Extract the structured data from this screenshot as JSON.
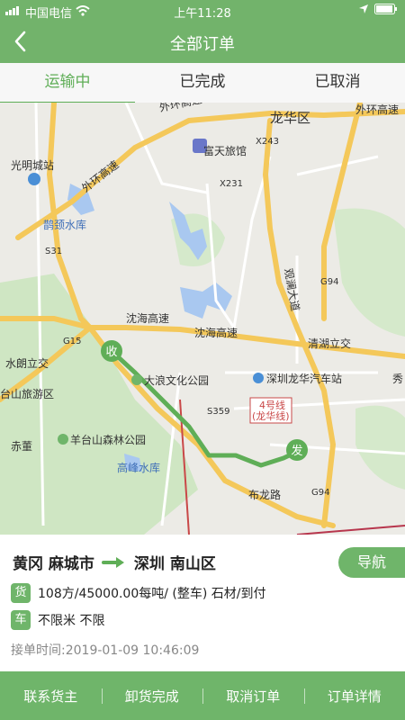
{
  "status_bar": {
    "carrier": "中国电信",
    "time": "上午11:28"
  },
  "nav": {
    "title": "全部订单"
  },
  "tabs": [
    {
      "label": "运输中",
      "active": true
    },
    {
      "label": "已完成",
      "active": false
    },
    {
      "label": "已取消",
      "active": false
    }
  ],
  "map": {
    "labels": {
      "huanhuan": "外环高速",
      "longhua": "龙华区",
      "waihuan_right": "外环高速",
      "futian": "富天旅馆",
      "x243": "X243",
      "guangming": "光明城站",
      "waihuan_left": "外环高速",
      "x231": "X231",
      "quejing": "鹊颈水库",
      "s31": "S31",
      "guanlan": "观澜大道",
      "g94a": "G94",
      "shenhai_left": "沈海高速",
      "shenhai_mid": "沈海高速",
      "qinghu": "清湖立交",
      "g15": "G15",
      "shuirun": "水朗立交",
      "dalang": "大浪文化公园",
      "longhua_station": "深圳龙华汽车站",
      "xiu": "秀",
      "taishan": "台山旅游区",
      "metro": "4号线",
      "metro_sub": "(龙华线)",
      "s359": "S359",
      "chidong": "赤董",
      "yangtai": "羊台山森林公园",
      "gaofeng": "高峰水库",
      "bulong": "布龙路",
      "g94b": "G94"
    },
    "marker_receive": "收",
    "marker_send": "发",
    "colors": {
      "route": "#5fae57",
      "highway": "#f4c85a",
      "water": "#a9c8f0",
      "park": "#bfe0b0"
    }
  },
  "order": {
    "from": "黄冈 麻城市",
    "to": "深圳 南山区",
    "nav_button": "导航",
    "cargo_badge": "货",
    "cargo_text": "108方/45000.00每吨/ (整车) 石材/到付",
    "vehicle_badge": "车",
    "vehicle_text": "不限米 不限",
    "accept_time": "接单时间:2019-01-09 10:46:09"
  },
  "actions": [
    {
      "label": "联系货主"
    },
    {
      "label": "卸货完成"
    },
    {
      "label": "取消订单"
    },
    {
      "label": "订单详情"
    }
  ]
}
